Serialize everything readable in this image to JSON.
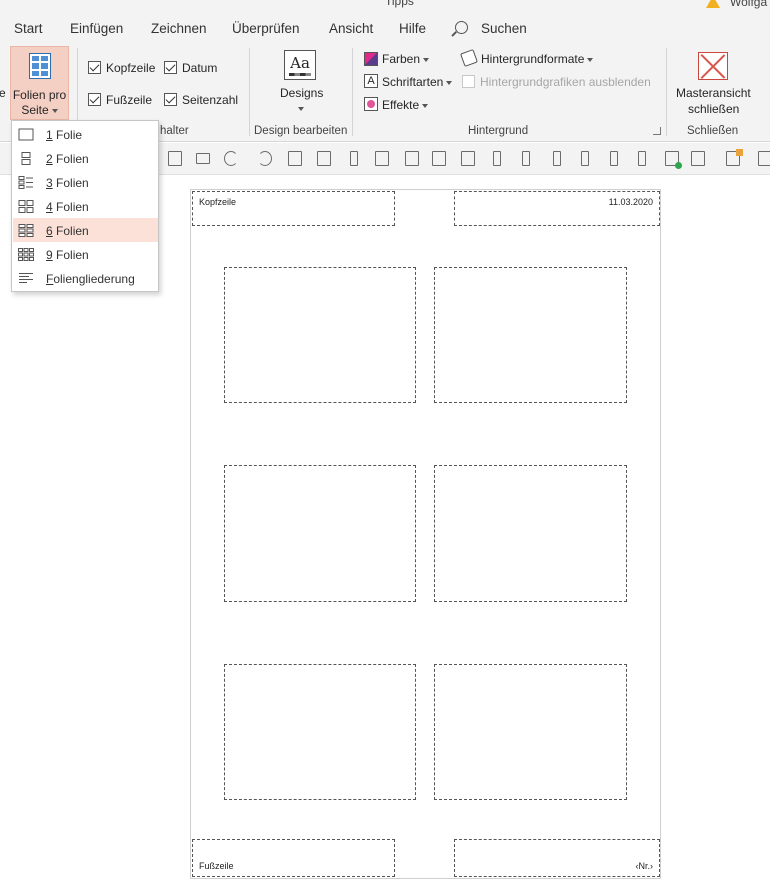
{
  "title_bar": {
    "title": "Tipps",
    "user": "Wolfga"
  },
  "tabs": [
    {
      "label": "Start"
    },
    {
      "label": "Einfügen"
    },
    {
      "label": "Zeichnen"
    },
    {
      "label": "Überprüfen"
    },
    {
      "label": "Ansicht"
    },
    {
      "label": "Hilfe"
    },
    {
      "label": "Suchen"
    }
  ],
  "ribbon": {
    "cut_left_text": "e",
    "folien_pro_seite": {
      "line1": "Folien pro",
      "line2": "Seite"
    },
    "placeholders": {
      "kopfzeile": "Kopfzeile",
      "datum": "Datum",
      "fusszeile": "Fußzeile",
      "seitenzahl": "Seitenzahl",
      "group_label_visible": "halter"
    },
    "design": {
      "button": "Designs",
      "group_label": "Design bearbeiten"
    },
    "hintergrund": {
      "farben": "Farben",
      "schriftarten": "Schriftarten",
      "effekte": "Effekte",
      "hintergrundformate": "Hintergrundformate",
      "hintergrundgrafiken": "Hintergrundgrafiken ausblenden",
      "group_label": "Hintergrund"
    },
    "schliessen": {
      "line1": "Masteransicht",
      "line2": "schließen",
      "group_label": "Schließen"
    }
  },
  "dropdown": {
    "items": [
      {
        "label": "1 Folie",
        "key": "1",
        "rest": " Folie",
        "icon": "one-slide-icon"
      },
      {
        "label": "2 Folien",
        "key": "2",
        "rest": " Folien",
        "icon": "two-slides-icon"
      },
      {
        "label": "3 Folien",
        "key": "3",
        "rest": " Folien",
        "icon": "three-slides-icon"
      },
      {
        "label": "4 Folien",
        "key": "4",
        "rest": " Folien",
        "icon": "four-slides-icon"
      },
      {
        "label": "6 Folien",
        "key": "6",
        "rest": " Folien",
        "icon": "six-slides-icon"
      },
      {
        "label": "9 Folien",
        "key": "9",
        "rest": " Folien",
        "icon": "nine-slides-icon"
      },
      {
        "label": "Foliengliederung",
        "key": "F",
        "rest": "oliengliederung",
        "icon": "outline-icon"
      }
    ],
    "selected": "6 Folien"
  },
  "handout": {
    "header": "Kopfzeile",
    "date": "11.03.2020",
    "footer": "Fußzeile",
    "page_number": "‹Nr.›"
  },
  "colors": {
    "accent_selected": "#f4cfc3",
    "menu_selected": "#fbe1d8",
    "ribbon_bg": "#f3f3f3",
    "close_red": "#d8574c"
  }
}
